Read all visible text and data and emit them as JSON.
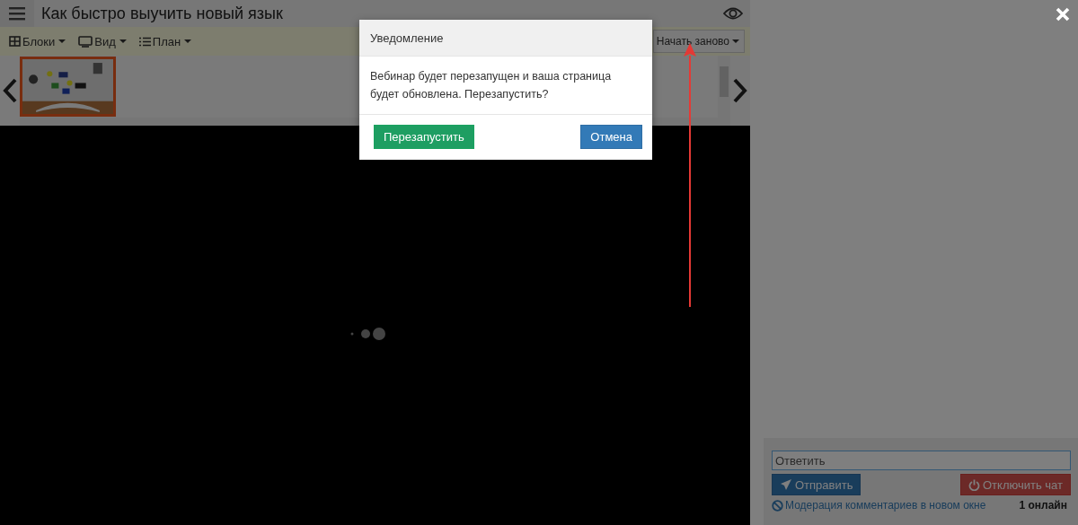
{
  "header": {
    "title": "Как быстро выучить новый язык"
  },
  "toolbar": {
    "menus": [
      {
        "kind": "blocks",
        "label": "Блоки"
      },
      {
        "kind": "view",
        "label": "Вид"
      },
      {
        "kind": "plan",
        "label": "План"
      }
    ],
    "restart_button": "Начать заново"
  },
  "slides": [
    {
      "kind": "picture",
      "selected": true
    }
  ],
  "dialog": {
    "title": "Уведомление",
    "message": "Вебинар будет перезапущен и ваша страница будет обновлена. Перезапустить?",
    "confirm": "Перезапустить",
    "cancel": "Отмена"
  },
  "chat": {
    "reply_placeholder": "Ответить",
    "send": "Отправить",
    "disconnect": "Отключить чат",
    "moderation_link": "Модерация комментариев в новом окне",
    "online": "1 онлайн"
  }
}
